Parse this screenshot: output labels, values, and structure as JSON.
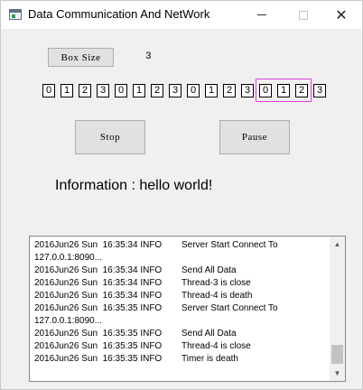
{
  "window": {
    "title": "Data Communication And NetWork",
    "minimize_symbol": "",
    "close_symbol": "✕"
  },
  "controls": {
    "box_size_label": "Box Size",
    "box_size_value": "3",
    "stop_label": "Stop",
    "pause_label": "Pause"
  },
  "cells": [
    "0",
    "1",
    "2",
    "3",
    "0",
    "1",
    "2",
    "3",
    "0",
    "1",
    "2",
    "3",
    "0",
    "1",
    "2",
    "3"
  ],
  "highlight_window": {
    "start_index": 12,
    "length": 3,
    "color": "#e040e0"
  },
  "info": {
    "text": "Information : hello world!"
  },
  "log": {
    "lines": [
      {
        "time": "2016Jun26 Sun  16:35:34 INFO",
        "msg": "Server Start Connect To"
      },
      {
        "time": "127.0.0.1:8090...",
        "msg": ""
      },
      {
        "time": "2016Jun26 Sun  16:35:34 INFO",
        "msg": "Send All Data"
      },
      {
        "time": "2016Jun26 Sun  16:35:34 INFO",
        "msg": "Thread-3 is close"
      },
      {
        "time": "2016Jun26 Sun  16:35:34 INFO",
        "msg": "Thread-4 is death"
      },
      {
        "time": "2016Jun26 Sun  16:35:35 INFO",
        "msg": "Server Start Connect To"
      },
      {
        "time": "127.0.0.1:8090...",
        "msg": ""
      },
      {
        "time": "2016Jun26 Sun  16:35:35 INFO",
        "msg": "Send All Data"
      },
      {
        "time": "2016Jun26 Sun  16:35:35 INFO",
        "msg": "Thread-4 is close"
      },
      {
        "time": "2016Jun26 Sun  16:35:35 INFO",
        "msg": "Timer is death"
      }
    ],
    "scroll_up_symbol": "▲",
    "scroll_down_symbol": "▼"
  }
}
